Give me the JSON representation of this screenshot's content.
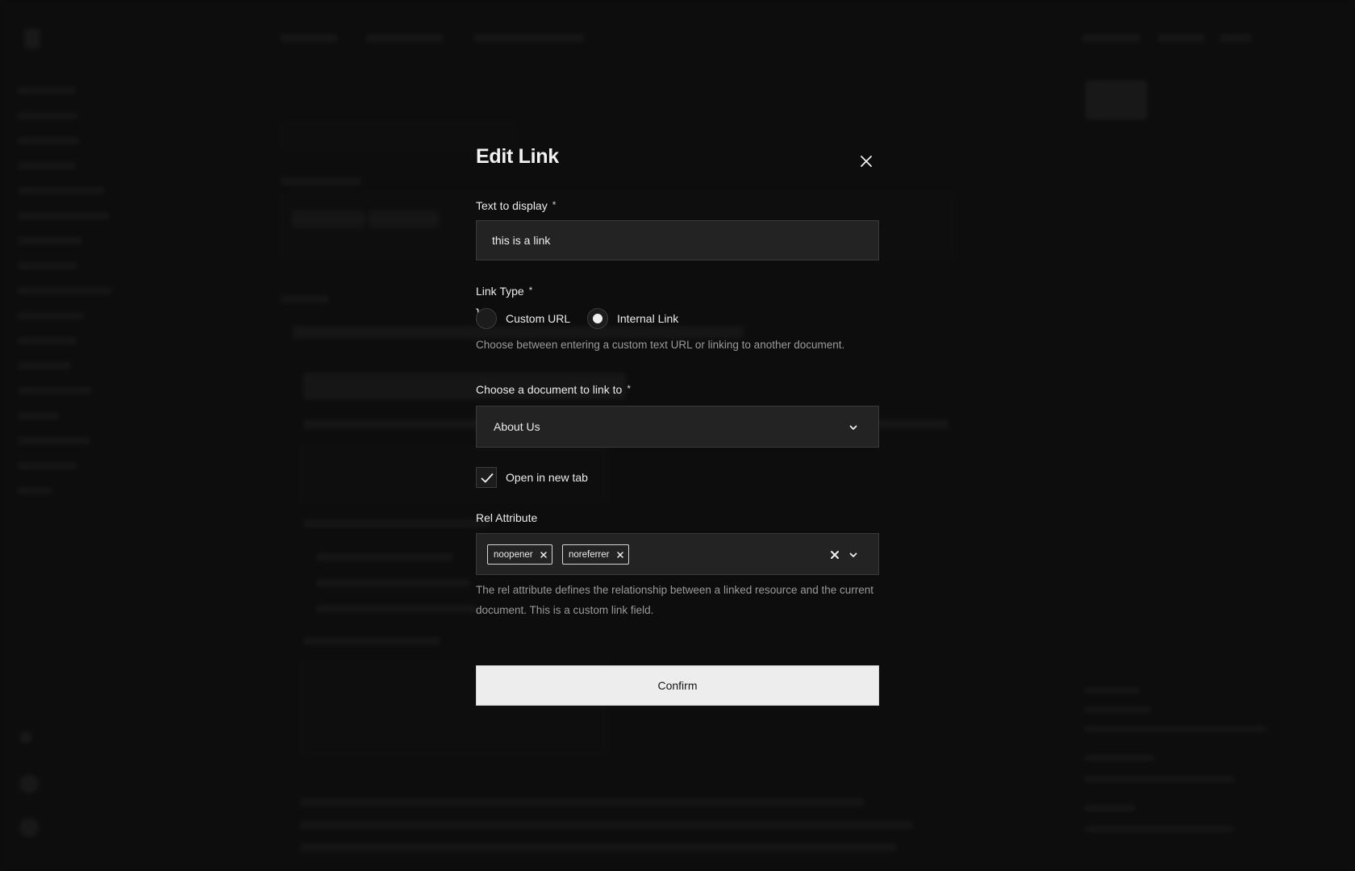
{
  "modal": {
    "title": "Edit Link",
    "close_icon": "close-icon",
    "text_field": {
      "label": "Text to display",
      "required_mark": "*",
      "value": "this is a link"
    },
    "link_type": {
      "label": "Link Type",
      "required_mark": "*",
      "options": [
        {
          "label": "Custom URL",
          "selected": false
        },
        {
          "label": "Internal Link",
          "selected": true
        }
      ],
      "help": "Choose between entering a custom text URL or linking to another document."
    },
    "document": {
      "label": "Choose a document to link to",
      "required_mark": "*",
      "selected": "About Us",
      "icon": "chevron-down-icon"
    },
    "new_tab": {
      "label": "Open in new tab",
      "checked": true,
      "icon": "check-icon"
    },
    "rel": {
      "label": "Rel Attribute",
      "tags": [
        "noopener",
        "noreferrer"
      ],
      "help": "The rel attribute defines the relationship between a linked resource and the current document. This is a custom link field."
    },
    "confirm_label": "Confirm"
  },
  "colors": {
    "backdrop": "#121212",
    "field_bg": "#232323",
    "field_border": "#3a3a3a",
    "button_bg": "#ededed",
    "text": "#ececec",
    "muted_text": "#9a9a9a"
  }
}
